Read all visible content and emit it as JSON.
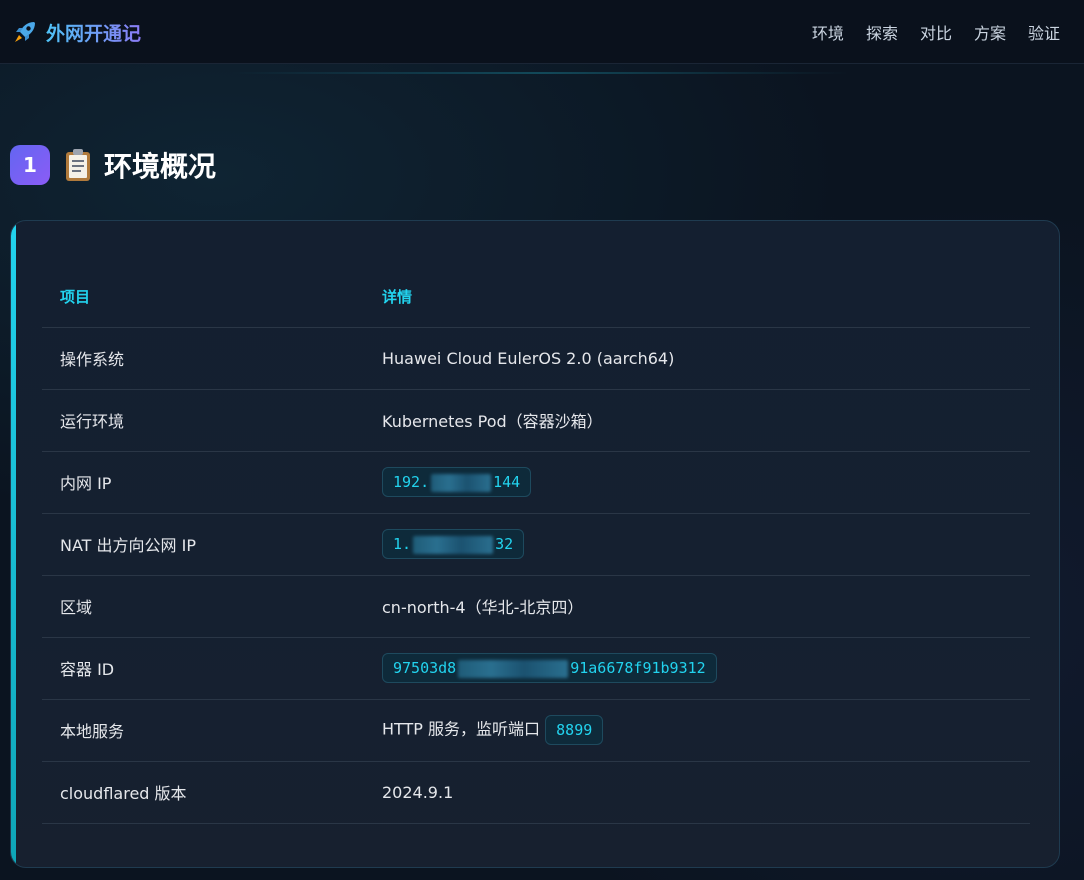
{
  "brand": {
    "title": "外网开通记",
    "icon": "rocket-icon"
  },
  "nav": {
    "links": [
      "环境",
      "探索",
      "对比",
      "方案",
      "验证"
    ]
  },
  "section": {
    "number": "1",
    "icon": "clipboard-icon",
    "title": "环境概况"
  },
  "table": {
    "headers": [
      "项目",
      "详情"
    ],
    "rows": [
      {
        "key": "操作系统",
        "value": "Huawei Cloud EulerOS 2.0 (aarch64)"
      },
      {
        "key": "运行环境",
        "value": "Kubernetes Pod（容器沙箱）"
      },
      {
        "key": "内网 IP",
        "value_prefix": "192.",
        "value_suffix": "144",
        "redacted": true
      },
      {
        "key": "NAT 出方向公网 IP",
        "value_prefix": "1.",
        "value_suffix": "32",
        "redacted": true
      },
      {
        "key": "区域",
        "value": "cn-north-4（华北-北京四）"
      },
      {
        "key": "容器 ID",
        "value_prefix": "97503d8",
        "value_suffix": "91a6678f91b9312",
        "redacted": true
      },
      {
        "key": "本地服务",
        "value": "HTTP 服务，监听端口",
        "port": "8899"
      },
      {
        "key": "cloudflared 版本",
        "value": "2024.9.1"
      }
    ]
  },
  "colors": {
    "accent": "#22d3ee",
    "section_badge_from": "#6366f1",
    "section_badge_to": "#8b5cf6",
    "background": "#0b1420",
    "card_border": "#1f3b50"
  }
}
